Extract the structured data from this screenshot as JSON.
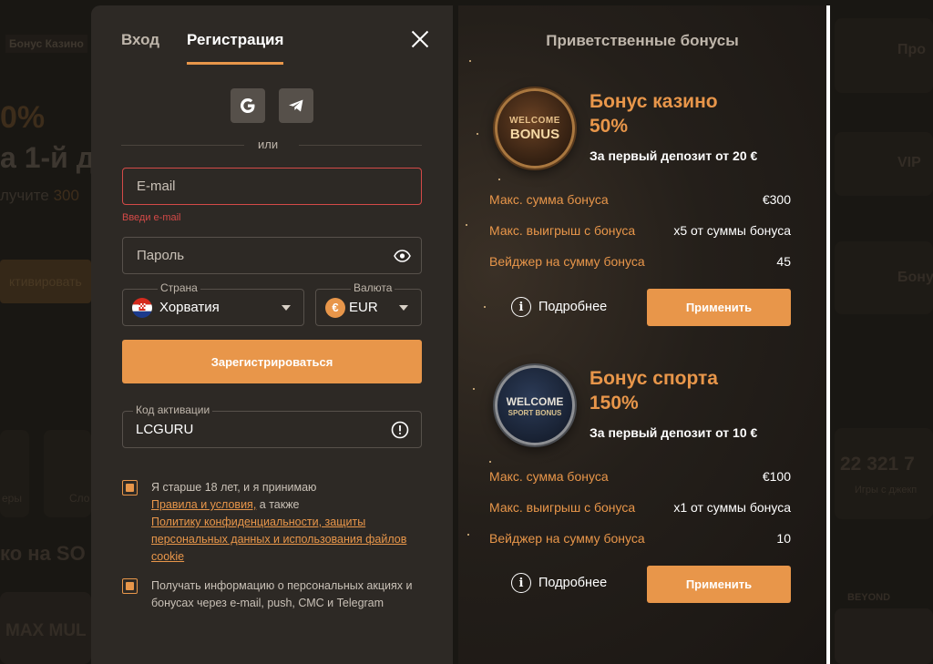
{
  "background": {
    "badge": "Бонус Казино",
    "percent": "0%",
    "headline": "а 1-й д",
    "sub_prefix": "лучите",
    "sub_value": "300",
    "activate": "ктивировать",
    "promo": "ко на SO",
    "max": "MAX MUL",
    "cat1": "еры",
    "cat2": "Сло",
    "right1": "Про",
    "right2": "VIP",
    "right3": "Бону",
    "count": "22 321 7",
    "count_sub": "Игры с джекп",
    "beyond": "BEYOND"
  },
  "modal": {
    "tabs": [
      {
        "label": "Вход"
      },
      {
        "label": "Регистрация"
      }
    ],
    "divider": "или",
    "email": {
      "placeholder": "E-mail",
      "error": "Введи e-mail"
    },
    "password": {
      "placeholder": "Пароль"
    },
    "country": {
      "legend": "Страна",
      "value": "Хорватия"
    },
    "currency": {
      "legend": "Валюта",
      "value": "EUR",
      "symbol": "€"
    },
    "register_button": "Зарегистрироваться",
    "activation": {
      "legend": "Код активации",
      "value": "LCGURU"
    },
    "terms": {
      "text1": "Я старше 18 лет, и я принимаю",
      "link1": "Правила и условия,",
      "text2": " а также",
      "link2": "Политику конфиденциальности, защиты персональных данных и использования файлов cookie"
    },
    "newsletter": "Получать информацию о персональных акциях и бонусах через e-mail, push, СМС и Telegram"
  },
  "bonuses": {
    "title": "Приветственные бонусы",
    "items": [
      {
        "medal_line1": "WELCOME",
        "medal_line2": "BONUS",
        "title_line1": "Бонус казино",
        "title_line2": "50%",
        "subtitle": "За первый депозит от 20 €",
        "rows": [
          {
            "k": "Макс. сумма бонуса",
            "v": "€300"
          },
          {
            "k": "Макс. выигрыш с бонуса",
            "v": "x5 от суммы бонуса"
          },
          {
            "k": "Вейджер на сумму бонуса",
            "v": "45"
          }
        ],
        "more": "Подробнее",
        "apply": "Применить"
      },
      {
        "medal_line1": "WELCOME",
        "medal_line2": "SPORT BONUS",
        "title_line1": "Бонус спорта",
        "title_line2": "150%",
        "subtitle": "За первый депозит от 10 €",
        "rows": [
          {
            "k": "Макс. сумма бонуса",
            "v": "€100"
          },
          {
            "k": "Макс. выигрыш с бонуса",
            "v": "x1 от суммы бонуса"
          },
          {
            "k": "Вейджер на сумму бонуса",
            "v": "10"
          }
        ],
        "more": "Подробнее",
        "apply": "Применить"
      }
    ]
  },
  "colors": {
    "accent": "#e8964a",
    "panel": "#2d2925",
    "error": "#d44a48"
  }
}
